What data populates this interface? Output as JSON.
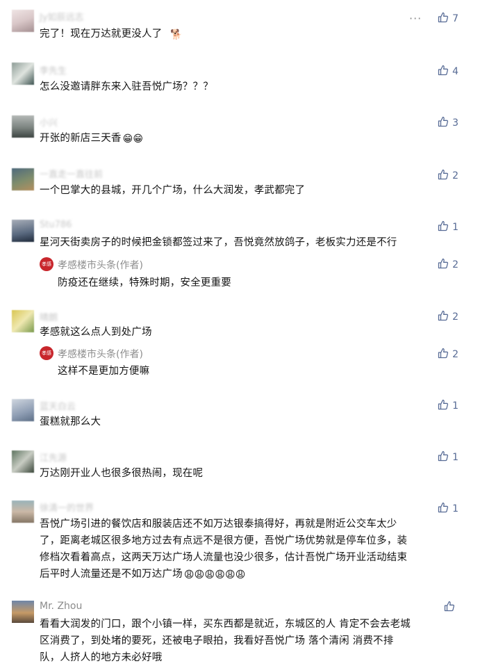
{
  "more_label": "···",
  "like_icon": "thumbs-up-icon",
  "accent_color": "#576b95",
  "comments": [
    {
      "name": "Jy如辰远志",
      "text": "完了！现在万达就更没人了",
      "emoji": "🐕",
      "likes": "7"
    },
    {
      "name": "李先生",
      "text": "怎么没邀请胖东来入驻吾悦广场？？？",
      "likes": "4"
    },
    {
      "name": "小兴",
      "text": "开张的新店三天香",
      "emoji": "😁😁",
      "likes": "3"
    },
    {
      "name": "一直走一直往前",
      "text": "一个巴掌大的县城，开几个广场，什么大润发，孝武都完了",
      "likes": "2"
    },
    {
      "name": "Stu786",
      "text": "星河天街卖房子的时候把金锁都签过来了，吾悦竟然放鸽子，老板实力还是不行",
      "likes": "1",
      "reply": {
        "avatar_text": "孝感楼市",
        "name": "孝感楼市头条(作者)",
        "text": "防疫还在继续，特殊时期，安全更重要",
        "likes": "2"
      }
    },
    {
      "name": "晴朗",
      "text": "孝感就这么点人到处广场",
      "likes": "2",
      "reply": {
        "avatar_text": "孝感楼市",
        "name": "孝感楼市头条(作者)",
        "text": "这样不是更加方便嘛",
        "likes": "2"
      }
    },
    {
      "name": "蓝天白云",
      "text": "蛋糕就那么大",
      "likes": "1"
    },
    {
      "name": "江先源",
      "text": "万达刚开业人也很多很热闹，现在呢",
      "likes": "1"
    },
    {
      "name": "徐清一的世界",
      "lines": [
        "吾悦广场引进的餐饮店和服装店还不如万达银泰搞得好，再就是附近公交车太少",
        "了，距离老城区很多地方过去有点远不是很方便，吾悦广场优势就是停车位多，装",
        "修档次看着高点，这两天万达广场人流量也没少很多，估计吾悦广场开业活动结束",
        "后平时人流量还是不如万达广场"
      ],
      "emoji": "😩😩😩😩😩😩",
      "likes": "1"
    },
    {
      "name": "Mr. Zhou",
      "lines": [
        "看看大润发的门口，跟个小镇一样，买东西都是就近，东城区的人 肯定不会去老城",
        "区消费了，到处堵的要死，还被电子眼拍，我看好吾悦广场 落个清闲 消费不排",
        "队，人挤人的地方未必好哦"
      ],
      "likes": ""
    }
  ]
}
